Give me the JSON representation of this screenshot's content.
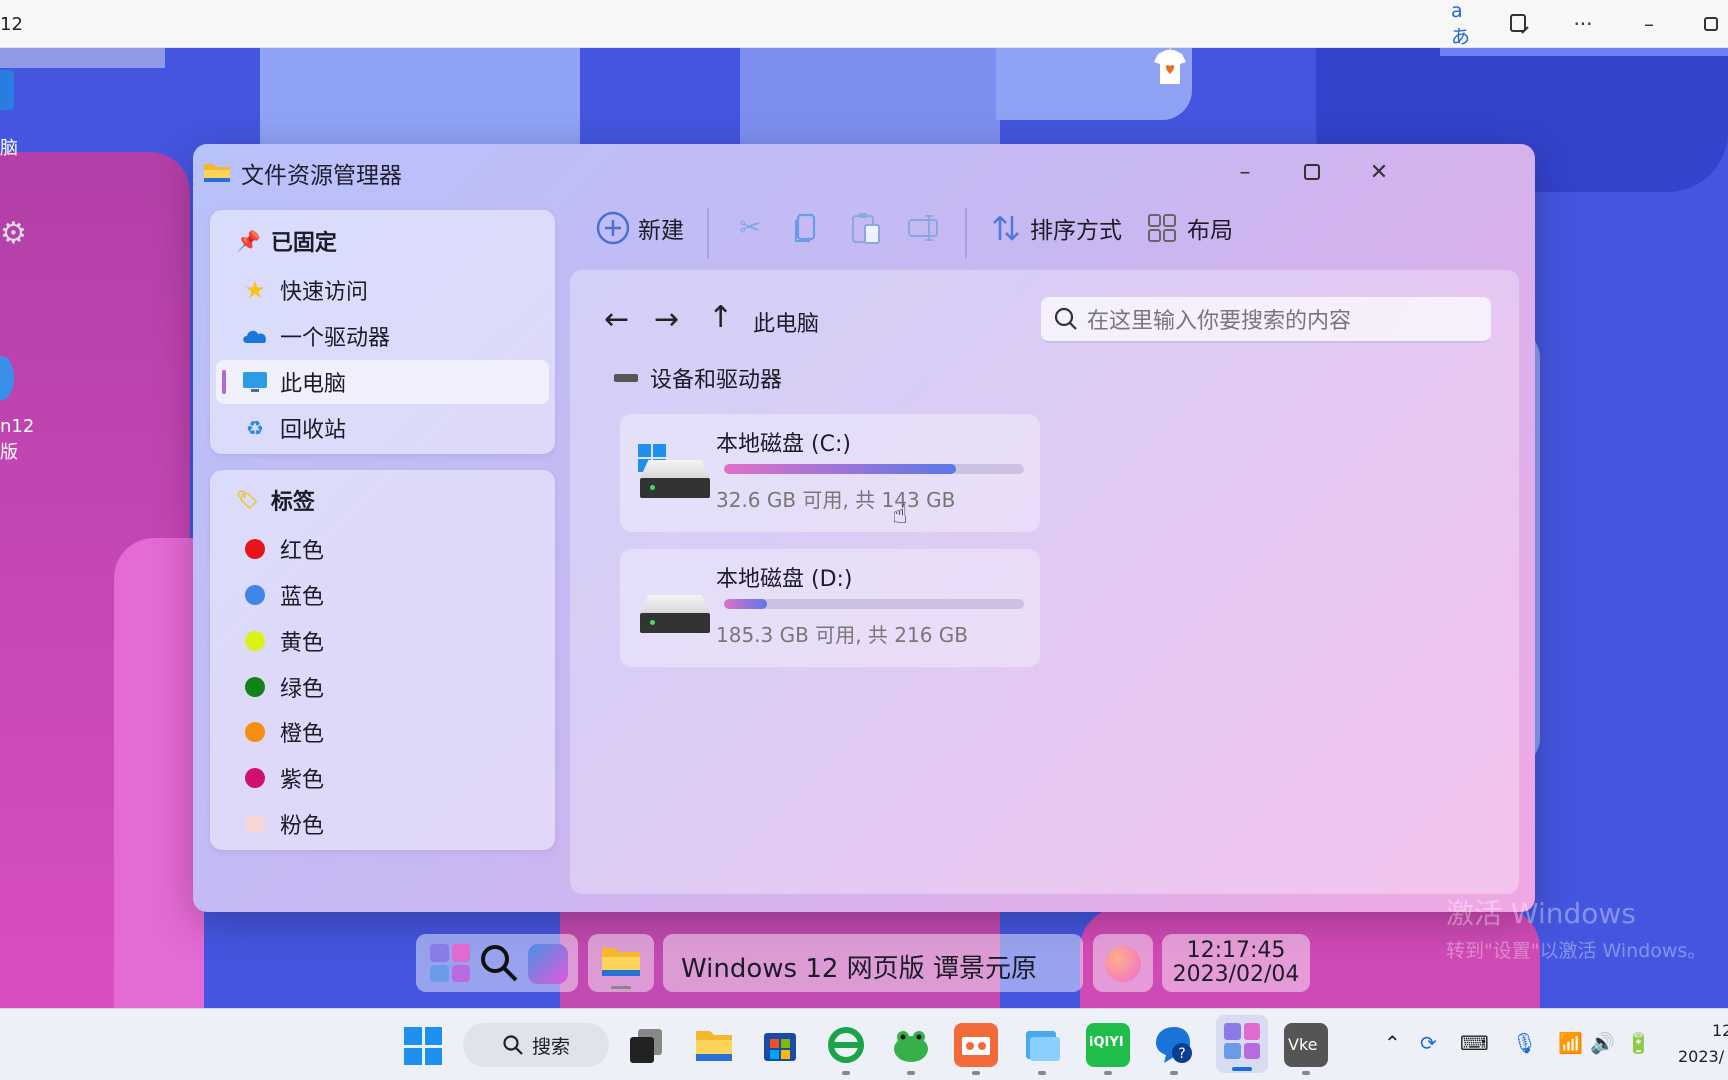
{
  "browser": {
    "title_fragment": "12",
    "icons": [
      "translate-icon",
      "read-aloud-icon",
      "more-icon",
      "minimize-icon",
      "restore-icon"
    ]
  },
  "desktop": {
    "icon_labels": [
      "脑",
      "n12",
      "版"
    ]
  },
  "window": {
    "title": "文件资源管理器",
    "controls": [
      "minimize",
      "maximize",
      "close"
    ]
  },
  "sidebar": {
    "pinned": {
      "title": "已固定",
      "items": [
        {
          "label": "快速访问",
          "icon": "star-icon"
        },
        {
          "label": "一个驱动器",
          "icon": "onedrive-cloud-icon"
        },
        {
          "label": "此电脑",
          "icon": "monitor-icon",
          "active": true
        },
        {
          "label": "回收站",
          "icon": "recycle-bin-icon"
        }
      ]
    },
    "tags": {
      "title": "标签",
      "items": [
        {
          "label": "红色",
          "color": "#e8141c"
        },
        {
          "label": "蓝色",
          "color": "#3f87e6"
        },
        {
          "label": "黄色",
          "color": "#d9f21a"
        },
        {
          "label": "绿色",
          "color": "#14821c"
        },
        {
          "label": "橙色",
          "color": "#f78e10"
        },
        {
          "label": "紫色",
          "color": "#d0106e"
        },
        {
          "label": "粉色",
          "color": "#fbd6d8"
        }
      ]
    }
  },
  "toolbar": {
    "new_label": "新建",
    "sort_label": "排序方式",
    "layout_label": "布局"
  },
  "nav": {
    "location": "此电脑",
    "search_placeholder": "在这里输入你要搜索的内容"
  },
  "content": {
    "section_title": "设备和驱动器",
    "drives": [
      {
        "name": "本地磁盘 (C:)",
        "free_text": "32.6 GB 可用, 共 143 GB",
        "used_fraction": 0.772
      },
      {
        "name": "本地磁盘 (D:)",
        "free_text": "185.3 GB 可用, 共 216 GB",
        "used_fraction": 0.142
      }
    ]
  },
  "inner_taskbar": {
    "window_title": "Windows 12 网页版 谭景元原",
    "time": "12:17:45",
    "date": "2023/02/04"
  },
  "watermark": {
    "line1": "激活 Windows",
    "line2": "转到\"设置\"以激活 Windows。"
  },
  "taskbar": {
    "search_label": "搜索",
    "clock_time": "12",
    "clock_date": "2023/"
  },
  "colors": {
    "accent": "#b467d8",
    "progress_start": "#e070c8",
    "progress_end": "#5a78e8"
  }
}
